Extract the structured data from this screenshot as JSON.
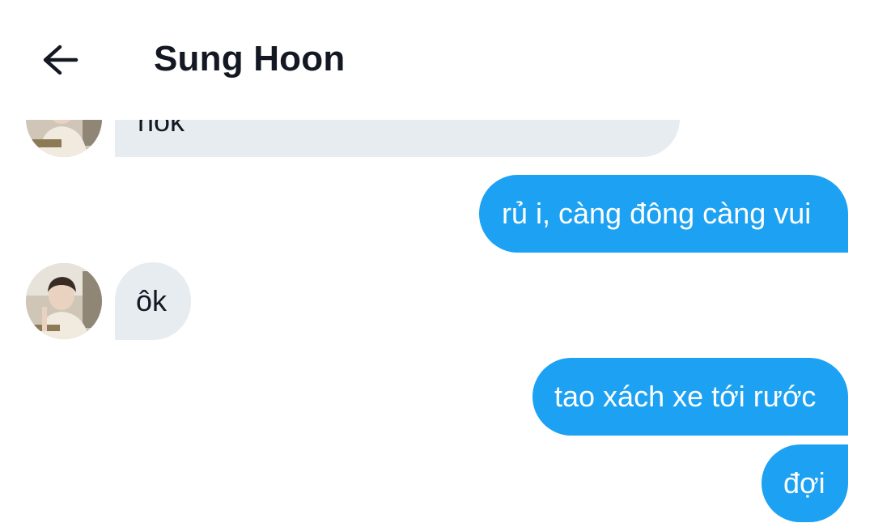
{
  "header": {
    "title": "Sung Hoon",
    "back_icon": "arrow-left-icon"
  },
  "messages": [
    {
      "side": "in",
      "text": "hok"
    },
    {
      "side": "out",
      "text": "rủ i, càng đông càng vui"
    },
    {
      "side": "in",
      "text": "ôk"
    },
    {
      "side": "out",
      "text": "tao xách xe tới rước"
    },
    {
      "side": "out",
      "text": "đợi"
    }
  ],
  "colors": {
    "incoming_bubble": "#e6ecf0",
    "outgoing_bubble": "#1da1f2",
    "title_text": "#141823"
  }
}
